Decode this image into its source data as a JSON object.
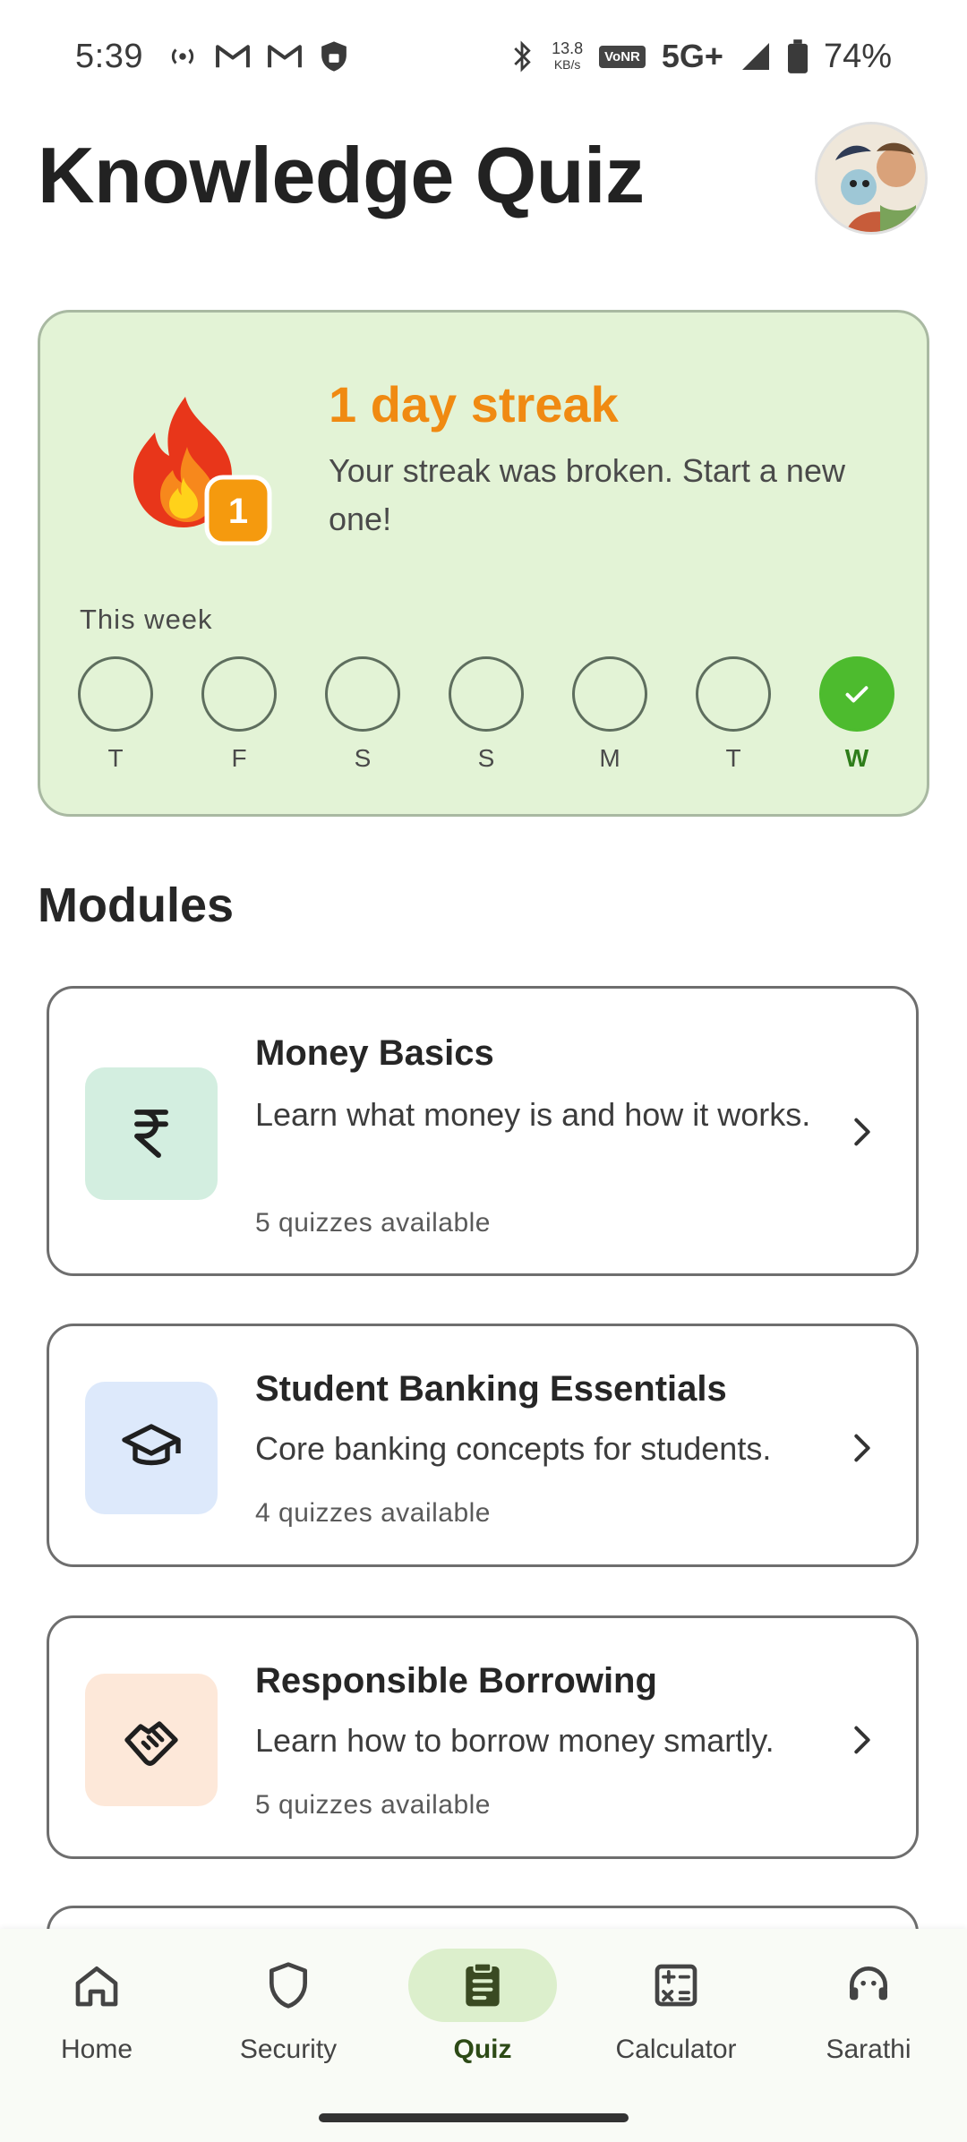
{
  "status_bar": {
    "time": "5:39",
    "speed_value": "13.8",
    "speed_unit": "KB/s",
    "vonr": "VoNR",
    "network": "5G+",
    "battery": "74%"
  },
  "header": {
    "title": "Knowledge Quiz"
  },
  "streak": {
    "badge_number": "1",
    "title": "1 day streak",
    "description": "Your streak was broken. Start a new one!",
    "week_label": "This week",
    "days": [
      {
        "letter": "T",
        "done": false
      },
      {
        "letter": "F",
        "done": false
      },
      {
        "letter": "S",
        "done": false
      },
      {
        "letter": "S",
        "done": false
      },
      {
        "letter": "M",
        "done": false
      },
      {
        "letter": "T",
        "done": false
      },
      {
        "letter": "W",
        "done": true
      }
    ],
    "colors": {
      "title": "#f08a12",
      "card_bg": "#e3f3d6",
      "done": "#4dbb2e"
    }
  },
  "modules": {
    "section_title": "Modules",
    "items": [
      {
        "title": "Money Basics",
        "description": "Learn what money is and how it works.",
        "count": "5 quizzes available",
        "icon": "rupee-icon",
        "icon_bg": "#d3eee0"
      },
      {
        "title": "Student Banking Essentials",
        "description": "Core banking concepts for students.",
        "count": "4 quizzes available",
        "icon": "graduation-cap-icon",
        "icon_bg": "#dde9fb"
      },
      {
        "title": "Responsible Borrowing",
        "description": "Learn how to borrow money smartly.",
        "count": "5 quizzes available",
        "icon": "handshake-icon",
        "icon_bg": "#fde8d9"
      }
    ]
  },
  "bottom_nav": {
    "items": [
      {
        "label": "Home",
        "icon": "home-icon",
        "active": false
      },
      {
        "label": "Security",
        "icon": "shield-icon",
        "active": false
      },
      {
        "label": "Quiz",
        "icon": "clipboard-icon",
        "active": true
      },
      {
        "label": "Calculator",
        "icon": "calculator-icon",
        "active": false
      },
      {
        "label": "Sarathi",
        "icon": "headset-icon",
        "active": false
      }
    ]
  }
}
